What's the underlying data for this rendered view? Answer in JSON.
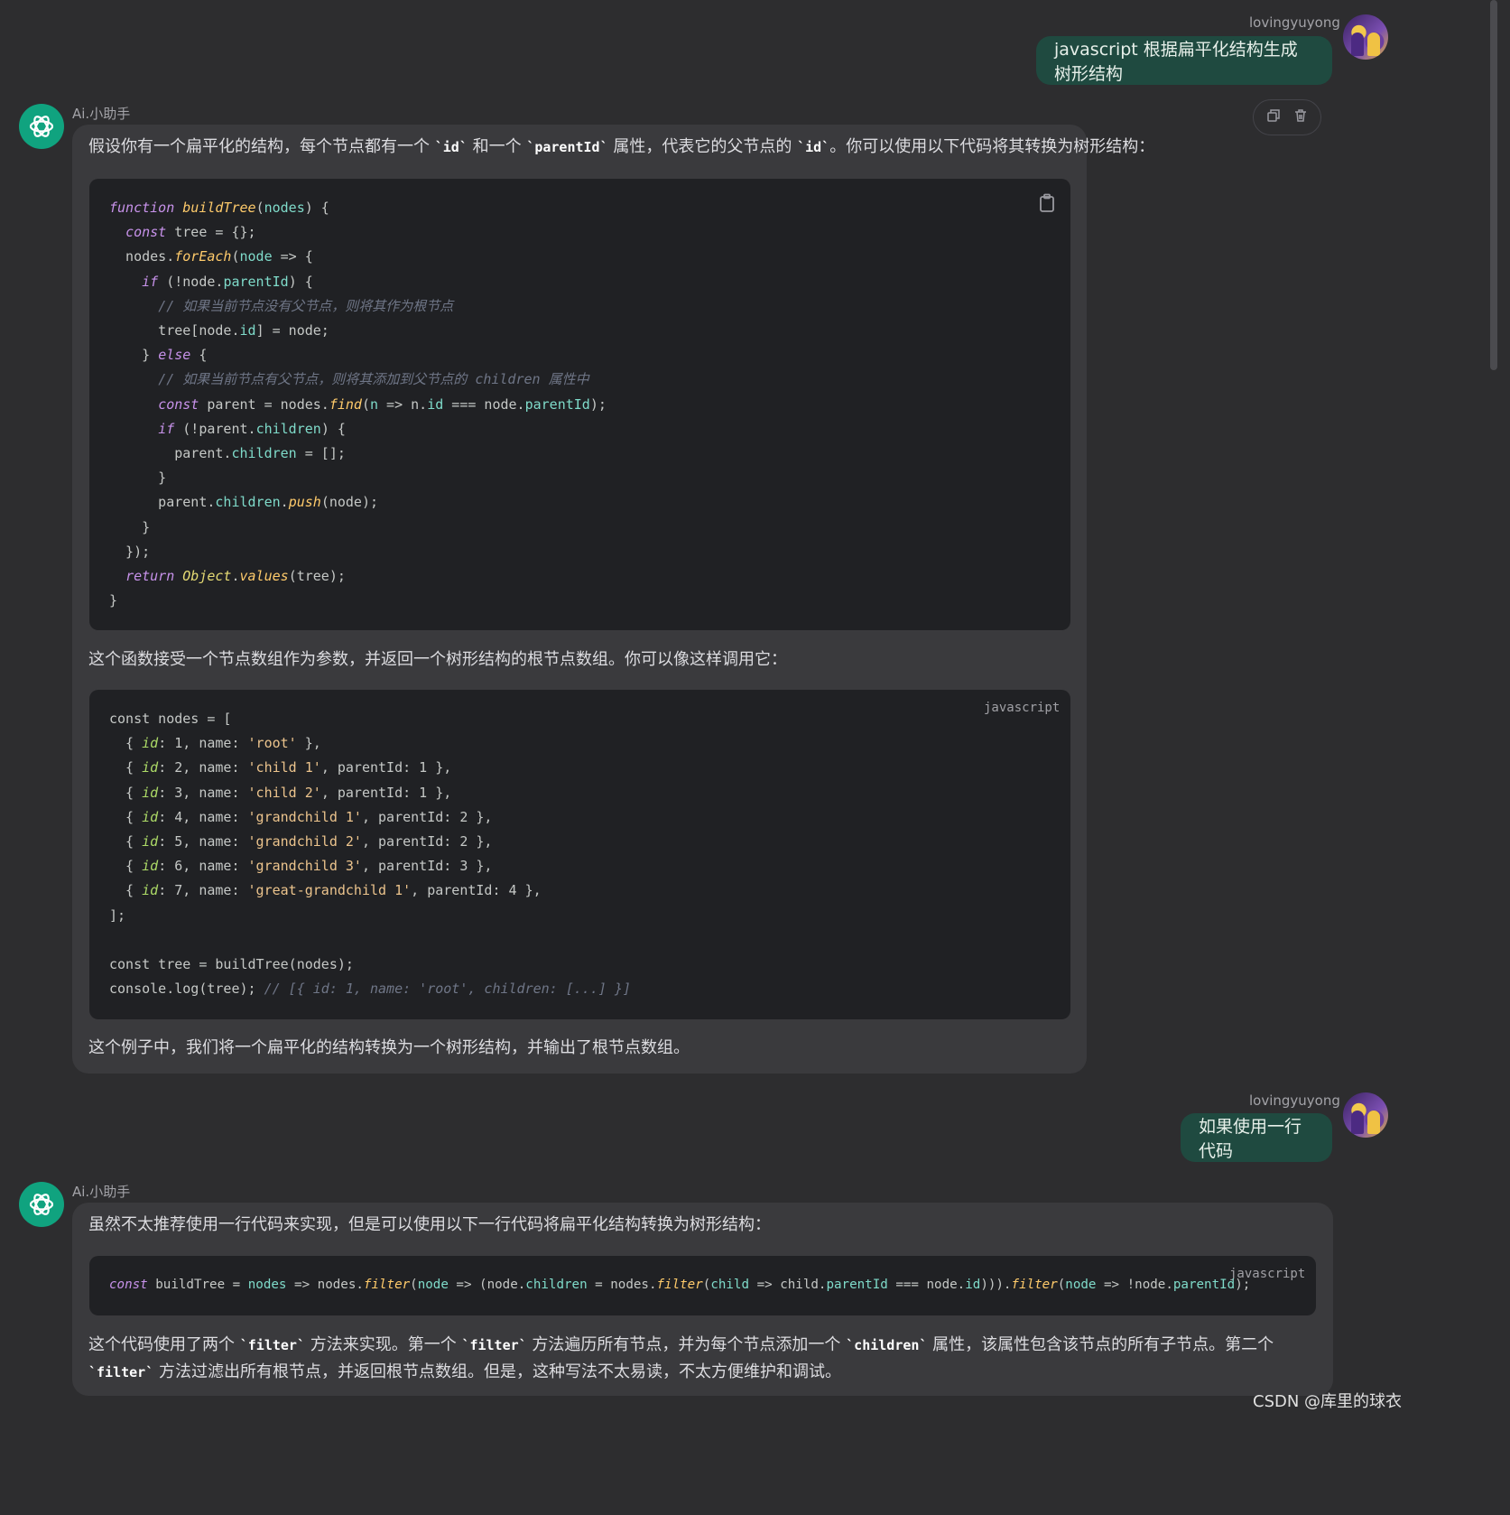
{
  "messages": {
    "user1": {
      "username": "lovingyuyong",
      "text": "javascript 根据扁平化结构生成树形结构"
    },
    "bot1": {
      "name": "Ai.小助手",
      "intro": {
        "t1": "假设你有一个扁平化的结构，每个节点都有一个 ",
        "c1": "`id`",
        "t2": " 和一个 ",
        "c2": "`parentId`",
        "t3": " 属性，代表它的父节点的 ",
        "c3": "`id`",
        "t4": "。你可以使用以下代码将其转换为树形结构："
      },
      "code1": [
        "function buildTree(nodes) {",
        "  const tree = {};",
        "  nodes.forEach(node => {",
        "    if (!node.parentId) {",
        "      // 如果当前节点没有父节点，则将其作为根节点",
        "      tree[node.id] = node;",
        "    } else {",
        "      // 如果当前节点有父节点，则将其添加到父节点的 children 属性中",
        "      const parent = nodes.find(n => n.id === node.parentId);",
        "      if (!parent.children) {",
        "        parent.children = [];",
        "      }",
        "      parent.children.push(node);",
        "    }",
        "  });",
        "  return Object.values(tree);",
        "}"
      ],
      "middle": "这个函数接受一个节点数组作为参数，并返回一个树形结构的根节点数组。你可以像这样调用它：",
      "code2_lang": "javascript",
      "code2": [
        "const nodes = [",
        "  { id: 1, name: 'root' },",
        "  { id: 2, name: 'child 1', parentId: 1 },",
        "  { id: 3, name: 'child 2', parentId: 1 },",
        "  { id: 4, name: 'grandchild 1', parentId: 2 },",
        "  { id: 5, name: 'grandchild 2', parentId: 2 },",
        "  { id: 6, name: 'grandchild 3', parentId: 3 },",
        "  { id: 7, name: 'great-grandchild 1', parentId: 4 },",
        "];",
        "",
        "const tree = buildTree(nodes);",
        "console.log(tree); // [{ id: 1, name: 'root', children: [...] }]"
      ],
      "outro": "这个例子中，我们将一个扁平化的结构转换为一个树形结构，并输出了根节点数组。"
    },
    "user2": {
      "username": "lovingyuyong",
      "text": "如果使用一行代码"
    },
    "bot2": {
      "name": "Ai.小助手",
      "intro": "虽然不太推荐使用一行代码来实现，但是可以使用以下一行代码将扁平化结构转换为树形结构：",
      "code_lang": "javascript",
      "code": "const buildTree = nodes => nodes.filter(node => (node.children = nodes.filter(child => child.parentId === node.id))).filter(node => !node.parentId);",
      "outro": {
        "t1": "这个代码使用了两个 ",
        "c1": "`filter`",
        "t2": " 方法来实现。第一个 ",
        "c2": "`filter`",
        "t3": " 方法遍历所有节点，并为每个节点添加一个 ",
        "c3": "`children`",
        "t4": " 属性，该属性包含该节点的所有子节点。第二个 ",
        "c4": "`filter`",
        "t5": " 方法过滤出所有根节点，并返回根节点数组。但是，这种写法不太易读，不太方便维护和调试。"
      }
    }
  },
  "watermark": "CSDN @库里的球衣",
  "colors": {
    "accent": "#10a37f",
    "user_bubble": "#1f4a40",
    "bot_bubble": "#3a3a3d",
    "code_bg": "#202124"
  }
}
